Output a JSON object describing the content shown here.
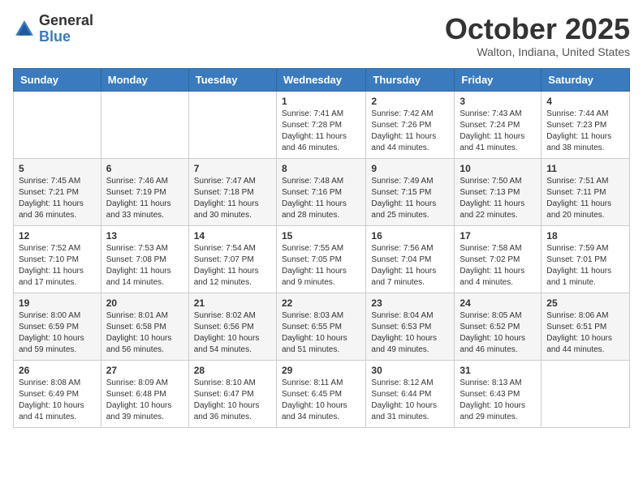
{
  "logo": {
    "general": "General",
    "blue": "Blue"
  },
  "title": "October 2025",
  "location": "Walton, Indiana, United States",
  "headers": [
    "Sunday",
    "Monday",
    "Tuesday",
    "Wednesday",
    "Thursday",
    "Friday",
    "Saturday"
  ],
  "weeks": [
    [
      {
        "day": "",
        "info": ""
      },
      {
        "day": "",
        "info": ""
      },
      {
        "day": "",
        "info": ""
      },
      {
        "day": "1",
        "info": "Sunrise: 7:41 AM\nSunset: 7:28 PM\nDaylight: 11 hours and 46 minutes."
      },
      {
        "day": "2",
        "info": "Sunrise: 7:42 AM\nSunset: 7:26 PM\nDaylight: 11 hours and 44 minutes."
      },
      {
        "day": "3",
        "info": "Sunrise: 7:43 AM\nSunset: 7:24 PM\nDaylight: 11 hours and 41 minutes."
      },
      {
        "day": "4",
        "info": "Sunrise: 7:44 AM\nSunset: 7:23 PM\nDaylight: 11 hours and 38 minutes."
      }
    ],
    [
      {
        "day": "5",
        "info": "Sunrise: 7:45 AM\nSunset: 7:21 PM\nDaylight: 11 hours and 36 minutes."
      },
      {
        "day": "6",
        "info": "Sunrise: 7:46 AM\nSunset: 7:19 PM\nDaylight: 11 hours and 33 minutes."
      },
      {
        "day": "7",
        "info": "Sunrise: 7:47 AM\nSunset: 7:18 PM\nDaylight: 11 hours and 30 minutes."
      },
      {
        "day": "8",
        "info": "Sunrise: 7:48 AM\nSunset: 7:16 PM\nDaylight: 11 hours and 28 minutes."
      },
      {
        "day": "9",
        "info": "Sunrise: 7:49 AM\nSunset: 7:15 PM\nDaylight: 11 hours and 25 minutes."
      },
      {
        "day": "10",
        "info": "Sunrise: 7:50 AM\nSunset: 7:13 PM\nDaylight: 11 hours and 22 minutes."
      },
      {
        "day": "11",
        "info": "Sunrise: 7:51 AM\nSunset: 7:11 PM\nDaylight: 11 hours and 20 minutes."
      }
    ],
    [
      {
        "day": "12",
        "info": "Sunrise: 7:52 AM\nSunset: 7:10 PM\nDaylight: 11 hours and 17 minutes."
      },
      {
        "day": "13",
        "info": "Sunrise: 7:53 AM\nSunset: 7:08 PM\nDaylight: 11 hours and 14 minutes."
      },
      {
        "day": "14",
        "info": "Sunrise: 7:54 AM\nSunset: 7:07 PM\nDaylight: 11 hours and 12 minutes."
      },
      {
        "day": "15",
        "info": "Sunrise: 7:55 AM\nSunset: 7:05 PM\nDaylight: 11 hours and 9 minutes."
      },
      {
        "day": "16",
        "info": "Sunrise: 7:56 AM\nSunset: 7:04 PM\nDaylight: 11 hours and 7 minutes."
      },
      {
        "day": "17",
        "info": "Sunrise: 7:58 AM\nSunset: 7:02 PM\nDaylight: 11 hours and 4 minutes."
      },
      {
        "day": "18",
        "info": "Sunrise: 7:59 AM\nSunset: 7:01 PM\nDaylight: 11 hours and 1 minute."
      }
    ],
    [
      {
        "day": "19",
        "info": "Sunrise: 8:00 AM\nSunset: 6:59 PM\nDaylight: 10 hours and 59 minutes."
      },
      {
        "day": "20",
        "info": "Sunrise: 8:01 AM\nSunset: 6:58 PM\nDaylight: 10 hours and 56 minutes."
      },
      {
        "day": "21",
        "info": "Sunrise: 8:02 AM\nSunset: 6:56 PM\nDaylight: 10 hours and 54 minutes."
      },
      {
        "day": "22",
        "info": "Sunrise: 8:03 AM\nSunset: 6:55 PM\nDaylight: 10 hours and 51 minutes."
      },
      {
        "day": "23",
        "info": "Sunrise: 8:04 AM\nSunset: 6:53 PM\nDaylight: 10 hours and 49 minutes."
      },
      {
        "day": "24",
        "info": "Sunrise: 8:05 AM\nSunset: 6:52 PM\nDaylight: 10 hours and 46 minutes."
      },
      {
        "day": "25",
        "info": "Sunrise: 8:06 AM\nSunset: 6:51 PM\nDaylight: 10 hours and 44 minutes."
      }
    ],
    [
      {
        "day": "26",
        "info": "Sunrise: 8:08 AM\nSunset: 6:49 PM\nDaylight: 10 hours and 41 minutes."
      },
      {
        "day": "27",
        "info": "Sunrise: 8:09 AM\nSunset: 6:48 PM\nDaylight: 10 hours and 39 minutes."
      },
      {
        "day": "28",
        "info": "Sunrise: 8:10 AM\nSunset: 6:47 PM\nDaylight: 10 hours and 36 minutes."
      },
      {
        "day": "29",
        "info": "Sunrise: 8:11 AM\nSunset: 6:45 PM\nDaylight: 10 hours and 34 minutes."
      },
      {
        "day": "30",
        "info": "Sunrise: 8:12 AM\nSunset: 6:44 PM\nDaylight: 10 hours and 31 minutes."
      },
      {
        "day": "31",
        "info": "Sunrise: 8:13 AM\nSunset: 6:43 PM\nDaylight: 10 hours and 29 minutes."
      },
      {
        "day": "",
        "info": ""
      }
    ]
  ]
}
